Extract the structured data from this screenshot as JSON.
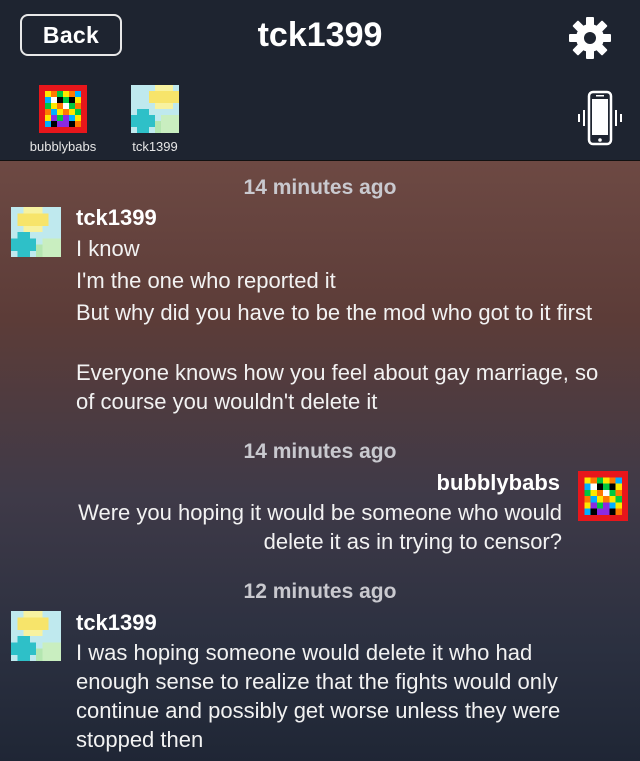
{
  "header": {
    "back_label": "Back",
    "title": "tck1399"
  },
  "participants": [
    {
      "name": "bubblybabs"
    },
    {
      "name": "tck1399"
    }
  ],
  "messages": [
    {
      "timestamp": "14 minutes ago",
      "sender": "tck1399",
      "lines": [
        "I know",
        "I'm the one who reported it",
        "But why did you have to be the mod who got to it first",
        "Everyone knows how you feel about gay marriage, so of course you wouldn't delete it"
      ]
    },
    {
      "timestamp": "14 minutes ago",
      "sender": "bubblybabs",
      "lines": [
        "Were you hoping it would be someone who would delete it as in trying to censor?"
      ]
    },
    {
      "timestamp": "12 minutes ago",
      "sender": "tck1399",
      "lines": [
        "I was hoping someone would delete it who had enough sense to realize that the fights would only continue and possibly get worse unless they were stopped then"
      ]
    }
  ],
  "colors": {
    "header_bg": "#1e2430",
    "timestamp": "#c9c9cf"
  }
}
